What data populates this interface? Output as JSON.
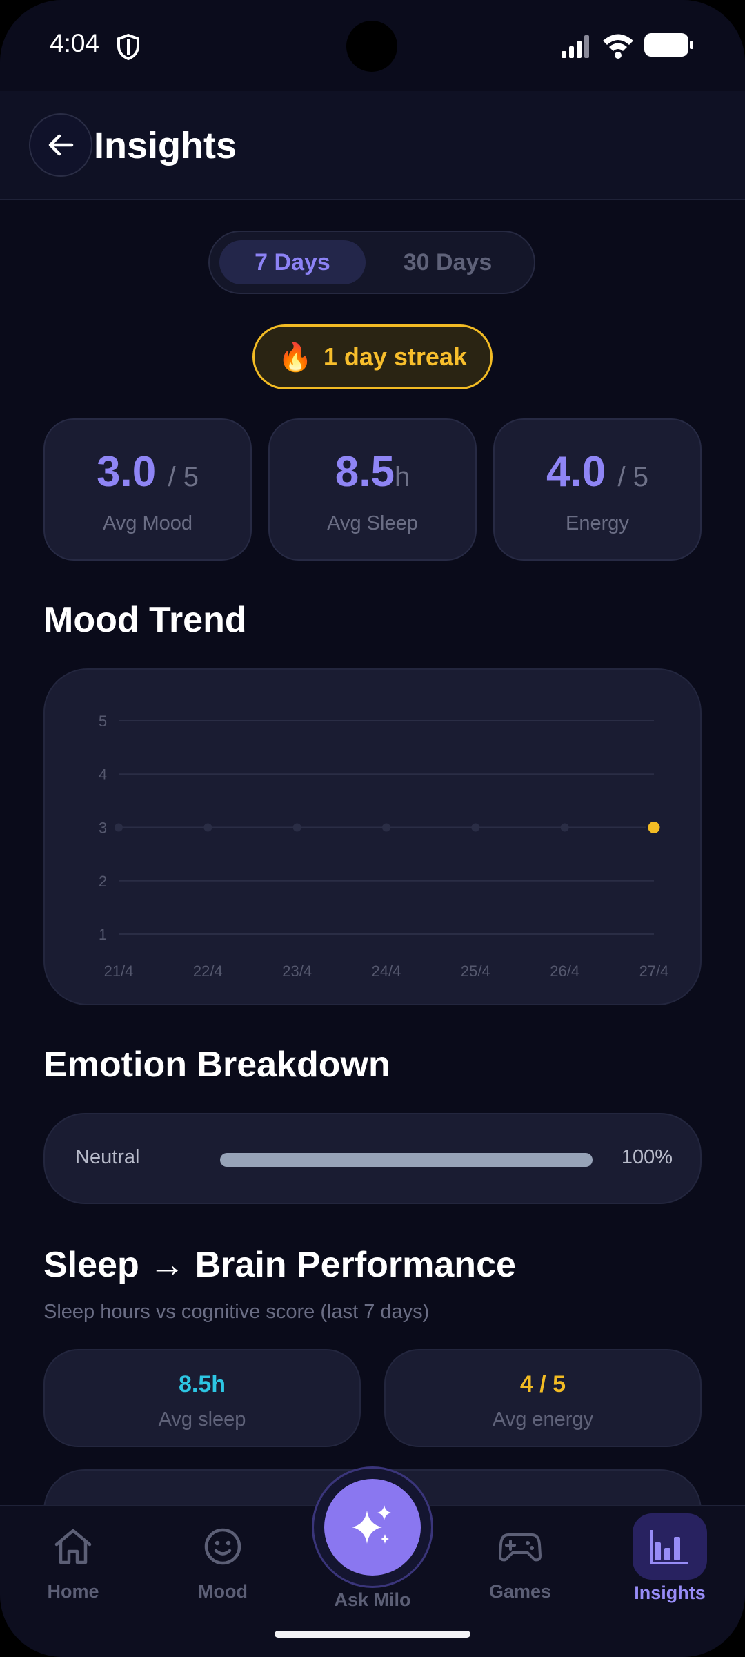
{
  "status_bar": {
    "time": "4:04"
  },
  "header": {
    "title": "Insights"
  },
  "period_tabs": [
    {
      "label": "7 Days",
      "selected": true
    },
    {
      "label": "30 Days",
      "selected": false
    }
  ],
  "streak": {
    "icon": "flame-icon",
    "text": "1 day streak",
    "color": "#f7be2c"
  },
  "stats": [
    {
      "value": "3.0",
      "unit": "/ 5",
      "label": "Avg Mood"
    },
    {
      "value": "8.5",
      "unit": "h",
      "label": "Avg Sleep"
    },
    {
      "value": "4.0",
      "unit": "/ 5",
      "label": "Energy"
    }
  ],
  "mood_trend": {
    "title": "Mood Trend"
  },
  "chart_data": {
    "type": "line",
    "title": "",
    "xlabel": "",
    "ylabel": "",
    "categories": [
      "21/4",
      "22/4",
      "23/4",
      "24/4",
      "25/4",
      "26/4",
      "27/4"
    ],
    "series": [
      {
        "values": [
          3,
          3,
          3,
          3,
          3,
          3,
          3
        ]
      }
    ],
    "highlight_index": 6,
    "yticks": [
      1,
      2,
      3,
      4,
      5
    ],
    "ylim": [
      1,
      5
    ],
    "grid": true,
    "colors": {
      "point": "#2a2d45",
      "highlight": "#f2bb24"
    }
  },
  "emotion_breakdown": {
    "title": "Emotion Breakdown",
    "items": [
      {
        "label": "Neutral",
        "percent_text": "100%",
        "fraction": 1.0
      }
    ]
  },
  "sleep_section": {
    "title": "Sleep → Brain Performance",
    "subtitle": "Sleep hours vs cognitive score (last 7 days)",
    "cards": [
      {
        "value": "8.5h",
        "label": "Avg sleep",
        "color": "#2dc6e3"
      },
      {
        "value": "4 / 5",
        "label": "Avg energy",
        "color": "#f2bb24"
      }
    ]
  },
  "nav": {
    "items": [
      {
        "label": "Home",
        "icon": "home-icon"
      },
      {
        "label": "Mood",
        "icon": "smiley-icon"
      },
      {
        "label": "Ask Milo",
        "icon": "sparkle-icon"
      },
      {
        "label": "Games",
        "icon": "gamepad-icon"
      },
      {
        "label": "Insights",
        "icon": "bar-chart-icon",
        "active": true
      }
    ]
  }
}
